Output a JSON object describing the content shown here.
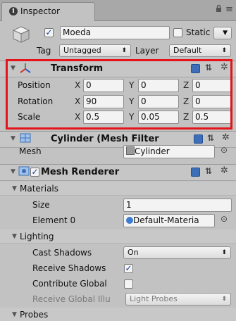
{
  "tab": {
    "title": "Inspector",
    "lock": "🔒",
    "menu": "≡"
  },
  "object": {
    "name": "Moeda",
    "static_label": "Static",
    "tag_label": "Tag",
    "tag_value": "Untagged",
    "layer_label": "Layer",
    "layer_value": "Default"
  },
  "transform": {
    "title": "Transform",
    "rows": [
      {
        "label": "Position",
        "x": "0",
        "y": "0",
        "z": "0"
      },
      {
        "label": "Rotation",
        "x": "90",
        "y": "0",
        "z": "0"
      },
      {
        "label": "Scale",
        "x": "0.5",
        "y": "0.05",
        "z": "0.5"
      }
    ],
    "axes": {
      "x": "X",
      "y": "Y",
      "z": "Z"
    }
  },
  "mesh_filter": {
    "title": "Cylinder (Mesh Filter",
    "mesh_label": "Mesh",
    "mesh_value": "Cylinder"
  },
  "mesh_renderer": {
    "title": "Mesh Renderer",
    "materials_label": "Materials",
    "size_label": "Size",
    "size_value": "1",
    "element_label": "Element 0",
    "element_value": "Default-Materia",
    "lighting_label": "Lighting",
    "cast_shadows_label": "Cast Shadows",
    "cast_shadows_value": "On",
    "receive_shadows_label": "Receive Shadows",
    "contribute_global_label": "Contribute Global",
    "receive_gi_label": "Receive Global Illu",
    "receive_gi_value": "Light Probes",
    "probes_label": "Probes"
  },
  "icons": {
    "dropdown": "⬍",
    "target": "⊙",
    "fold_open": "▼",
    "help": "",
    "preset": "⇅",
    "gear": "✲",
    "check": "✓"
  },
  "colors": {
    "highlight": "#e3151a",
    "background": "#c2c2c2",
    "help_blue": "#3d6fb8"
  }
}
